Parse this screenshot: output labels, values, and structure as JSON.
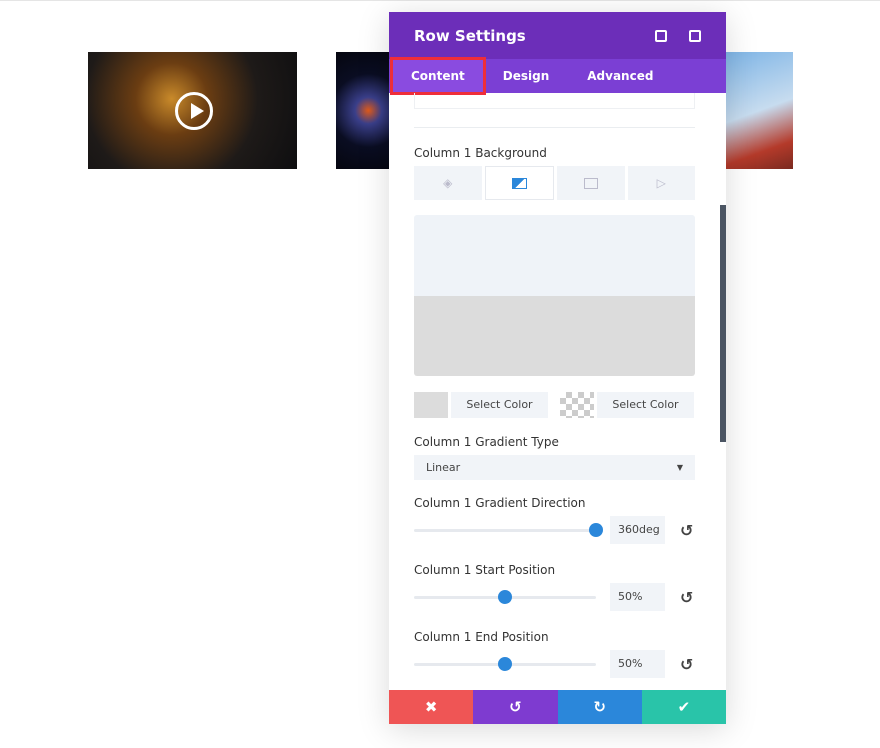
{
  "panel": {
    "title": "Row Settings",
    "tabs": [
      {
        "label": "Content",
        "active": true
      },
      {
        "label": "Design"
      },
      {
        "label": "Advanced"
      }
    ]
  },
  "background": {
    "label": "Column 1 Background",
    "tabs": [
      "color-fill-icon",
      "gradient-icon",
      "image-icon",
      "video-icon"
    ],
    "active_tab": "gradient",
    "gradient_preview": {
      "start_color": "#eff3f8",
      "end_color": "#dcdcdc"
    },
    "color1": {
      "swatch": "#dcdcdc",
      "label": "Select Color"
    },
    "color2": {
      "swatch": "transparent",
      "label": "Select Color"
    }
  },
  "gradient_type": {
    "label": "Column 1 Gradient Type",
    "value": "Linear"
  },
  "direction": {
    "label": "Column 1 Gradient Direction",
    "value": "360deg",
    "fraction": 1.0
  },
  "start": {
    "label": "Column 1 Start Position",
    "value": "50%",
    "fraction": 0.5
  },
  "end": {
    "label": "Column 1 End Position",
    "value": "50%",
    "fraction": 0.5
  },
  "footer": {
    "cancel": "✖",
    "undo": "↺",
    "redo": "↻",
    "save": "✔",
    "colors": {
      "cancel": "#ef5555",
      "undo": "#7e3bd0",
      "redo": "#2b87da",
      "save": "#29c4a9"
    }
  },
  "colors": {
    "header": "#6c2eb9",
    "tabs": "#7b3fd4",
    "accent": "#2b87da"
  }
}
